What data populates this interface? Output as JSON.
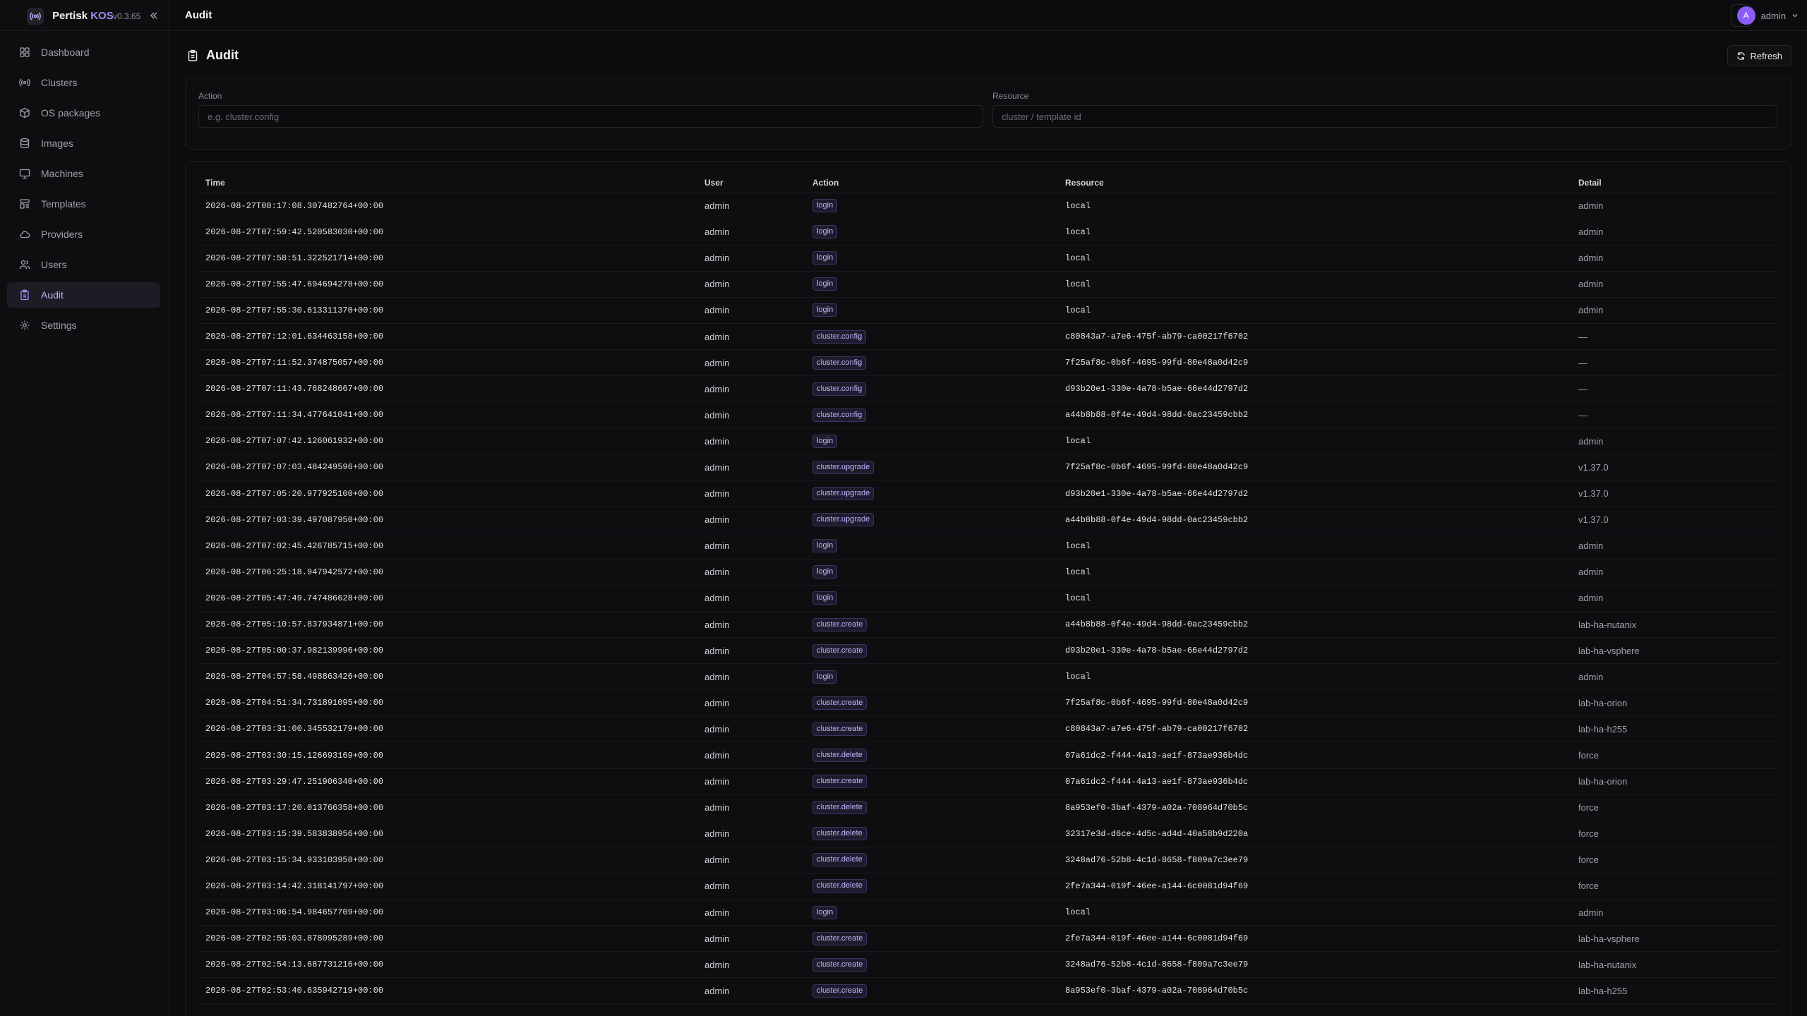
{
  "app": {
    "name_prefix": "Pertisk",
    "name_accent": "KOS",
    "version": "v0.3.65"
  },
  "sidebar": {
    "items": [
      {
        "label": "Dashboard",
        "icon": "dashboard-icon",
        "active": false
      },
      {
        "label": "Clusters",
        "icon": "clusters-icon",
        "active": false
      },
      {
        "label": "OS packages",
        "icon": "package-icon",
        "active": false
      },
      {
        "label": "Images",
        "icon": "database-icon",
        "active": false
      },
      {
        "label": "Machines",
        "icon": "monitor-icon",
        "active": false
      },
      {
        "label": "Templates",
        "icon": "template-icon",
        "active": false
      },
      {
        "label": "Providers",
        "icon": "cloud-icon",
        "active": false
      },
      {
        "label": "Users",
        "icon": "users-icon",
        "active": false
      },
      {
        "label": "Audit",
        "icon": "clipboard-icon",
        "active": true
      },
      {
        "label": "Settings",
        "icon": "gear-icon",
        "active": false
      }
    ]
  },
  "header": {
    "title": "Audit",
    "user": {
      "initial": "A",
      "name": "admin"
    }
  },
  "page": {
    "title": "Audit",
    "refresh_label": "Refresh"
  },
  "filters": {
    "action": {
      "label": "Action",
      "placeholder": "e.g. cluster.config",
      "value": ""
    },
    "resource": {
      "label": "Resource",
      "placeholder": "cluster / template id",
      "value": ""
    }
  },
  "table": {
    "columns": [
      "Time",
      "User",
      "Action",
      "Resource",
      "Detail"
    ],
    "rows": [
      {
        "time": "2026-08-27T08:17:08.307482764+00:00",
        "user": "admin",
        "action": "login",
        "resource": "local",
        "detail": "admin"
      },
      {
        "time": "2026-08-27T07:59:42.520583030+00:00",
        "user": "admin",
        "action": "login",
        "resource": "local",
        "detail": "admin"
      },
      {
        "time": "2026-08-27T07:58:51.322521714+00:00",
        "user": "admin",
        "action": "login",
        "resource": "local",
        "detail": "admin"
      },
      {
        "time": "2026-08-27T07:55:47.694694278+00:00",
        "user": "admin",
        "action": "login",
        "resource": "local",
        "detail": "admin"
      },
      {
        "time": "2026-08-27T07:55:30.613311370+00:00",
        "user": "admin",
        "action": "login",
        "resource": "local",
        "detail": "admin"
      },
      {
        "time": "2026-08-27T07:12:01.634463158+00:00",
        "user": "admin",
        "action": "cluster.config",
        "resource": "c80843a7-a7e6-475f-ab79-ca00217f6702",
        "detail": "—"
      },
      {
        "time": "2026-08-27T07:11:52.374875057+00:00",
        "user": "admin",
        "action": "cluster.config",
        "resource": "7f25af8c-0b6f-4695-99fd-80e48a0d42c9",
        "detail": "—"
      },
      {
        "time": "2026-08-27T07:11:43.768248667+00:00",
        "user": "admin",
        "action": "cluster.config",
        "resource": "d93b20e1-330e-4a78-b5ae-66e44d2797d2",
        "detail": "—"
      },
      {
        "time": "2026-08-27T07:11:34.477641041+00:00",
        "user": "admin",
        "action": "cluster.config",
        "resource": "a44b8b88-0f4e-49d4-98dd-0ac23459cbb2",
        "detail": "—"
      },
      {
        "time": "2026-08-27T07:07:42.126061932+00:00",
        "user": "admin",
        "action": "login",
        "resource": "local",
        "detail": "admin"
      },
      {
        "time": "2026-08-27T07:07:03.484249596+00:00",
        "user": "admin",
        "action": "cluster.upgrade",
        "resource": "7f25af8c-0b6f-4695-99fd-80e48a0d42c9",
        "detail": "v1.37.0"
      },
      {
        "time": "2026-08-27T07:05:20.977925100+00:00",
        "user": "admin",
        "action": "cluster.upgrade",
        "resource": "d93b20e1-330e-4a78-b5ae-66e44d2797d2",
        "detail": "v1.37.0"
      },
      {
        "time": "2026-08-27T07:03:39.497087950+00:00",
        "user": "admin",
        "action": "cluster.upgrade",
        "resource": "a44b8b88-0f4e-49d4-98dd-0ac23459cbb2",
        "detail": "v1.37.0"
      },
      {
        "time": "2026-08-27T07:02:45.426785715+00:00",
        "user": "admin",
        "action": "login",
        "resource": "local",
        "detail": "admin"
      },
      {
        "time": "2026-08-27T06:25:18.947942572+00:00",
        "user": "admin",
        "action": "login",
        "resource": "local",
        "detail": "admin"
      },
      {
        "time": "2026-08-27T05:47:49.747486628+00:00",
        "user": "admin",
        "action": "login",
        "resource": "local",
        "detail": "admin"
      },
      {
        "time": "2026-08-27T05:10:57.837934871+00:00",
        "user": "admin",
        "action": "cluster.create",
        "resource": "a44b8b88-0f4e-49d4-98dd-0ac23459cbb2",
        "detail": "lab-ha-nutanix"
      },
      {
        "time": "2026-08-27T05:00:37.982139996+00:00",
        "user": "admin",
        "action": "cluster.create",
        "resource": "d93b20e1-330e-4a78-b5ae-66e44d2797d2",
        "detail": "lab-ha-vsphere"
      },
      {
        "time": "2026-08-27T04:57:58.498863426+00:00",
        "user": "admin",
        "action": "login",
        "resource": "local",
        "detail": "admin"
      },
      {
        "time": "2026-08-27T04:51:34.731891095+00:00",
        "user": "admin",
        "action": "cluster.create",
        "resource": "7f25af8c-0b6f-4695-99fd-80e48a0d42c9",
        "detail": "lab-ha-orion"
      },
      {
        "time": "2026-08-27T03:31:00.345532179+00:00",
        "user": "admin",
        "action": "cluster.create",
        "resource": "c80843a7-a7e6-475f-ab79-ca00217f6702",
        "detail": "lab-ha-h255"
      },
      {
        "time": "2026-08-27T03:30:15.126693169+00:00",
        "user": "admin",
        "action": "cluster.delete",
        "resource": "07a61dc2-f444-4a13-ae1f-873ae936b4dc",
        "detail": "force"
      },
      {
        "time": "2026-08-27T03:29:47.251906340+00:00",
        "user": "admin",
        "action": "cluster.create",
        "resource": "07a61dc2-f444-4a13-ae1f-873ae936b4dc",
        "detail": "lab-ha-orion"
      },
      {
        "time": "2026-08-27T03:17:20.013766358+00:00",
        "user": "admin",
        "action": "cluster.delete",
        "resource": "8a953ef0-3baf-4379-a02a-708964d70b5c",
        "detail": "force"
      },
      {
        "time": "2026-08-27T03:15:39.583838956+00:00",
        "user": "admin",
        "action": "cluster.delete",
        "resource": "32317e3d-d6ce-4d5c-ad4d-40a58b9d220a",
        "detail": "force"
      },
      {
        "time": "2026-08-27T03:15:34.933103950+00:00",
        "user": "admin",
        "action": "cluster.delete",
        "resource": "3248ad76-52b8-4c1d-8658-f809a7c3ee79",
        "detail": "force"
      },
      {
        "time": "2026-08-27T03:14:42.318141797+00:00",
        "user": "admin",
        "action": "cluster.delete",
        "resource": "2fe7a344-019f-46ee-a144-6c0081d94f69",
        "detail": "force"
      },
      {
        "time": "2026-08-27T03:06:54.984657709+00:00",
        "user": "admin",
        "action": "login",
        "resource": "local",
        "detail": "admin"
      },
      {
        "time": "2026-08-27T02:55:03.878095289+00:00",
        "user": "admin",
        "action": "cluster.create",
        "resource": "2fe7a344-019f-46ee-a144-6c0081d94f69",
        "detail": "lab-ha-vsphere"
      },
      {
        "time": "2026-08-27T02:54:13.687731216+00:00",
        "user": "admin",
        "action": "cluster.create",
        "resource": "3248ad76-52b8-4c1d-8658-f809a7c3ee79",
        "detail": "lab-ha-nutanix"
      },
      {
        "time": "2026-08-27T02:53:40.635942719+00:00",
        "user": "admin",
        "action": "cluster.create",
        "resource": "8a953ef0-3baf-4379-a02a-708964d70b5c",
        "detail": "lab-ha-h255"
      }
    ]
  },
  "colors": {
    "accent": "#a78bfa",
    "background": "#0c0c0f",
    "badge_bg": "#1e1b2e"
  }
}
